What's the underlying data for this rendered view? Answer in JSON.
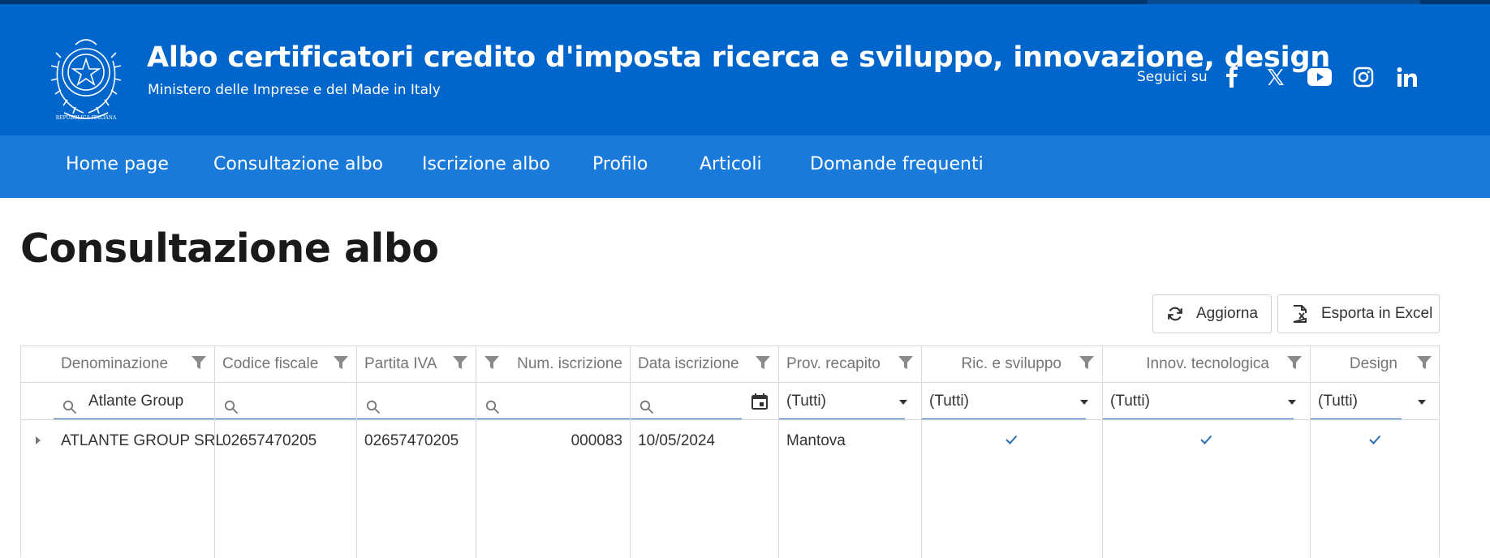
{
  "header": {
    "title": "Albo certificatori credito d'imposta ricerca e sviluppo, innovazione, design",
    "subtitle": "Ministero delle Imprese e del Made in Italy",
    "emblem_text": "REPUBBLICA ITALIANA",
    "follow_label": "Seguici su",
    "social": [
      "facebook-icon",
      "x-icon",
      "youtube-icon",
      "instagram-icon",
      "linkedin-icon"
    ],
    "background": "#0066cc"
  },
  "nav": {
    "items": [
      "Home page",
      "Consultazione albo",
      "Iscrizione albo",
      "Profilo",
      "Articoli",
      "Domande frequenti"
    ],
    "background": "#1a7ad9"
  },
  "page": {
    "title": "Consultazione albo"
  },
  "toolbar": {
    "refresh_label": "Aggiorna",
    "refresh_icon": "refresh-icon",
    "export_label": "Esporta in Excel",
    "export_icon": "excel-export-icon"
  },
  "grid": {
    "columns": [
      "Denominazione",
      "Codice fiscale",
      "Partita IVA",
      "Num. iscrizione",
      "Data iscrizione",
      "Prov. recapito",
      "Ric. e sviluppo",
      "Innov. tecnologica",
      "Design"
    ],
    "filters": {
      "denominazione": "Atlante Group",
      "prov_recapito": "(Tutti)",
      "ric_sviluppo": "(Tutti)",
      "innov_tecnologica": "(Tutti)",
      "design": "(Tutti)"
    },
    "rows": [
      {
        "denominazione": "ATLANTE GROUP SRL",
        "codice_fiscale": "02657470205",
        "partita_iva": "02657470205",
        "num_iscrizione": "000083",
        "data_iscrizione": "10/05/2024",
        "prov_recapito": "Mantova",
        "ric_sviluppo": true,
        "innov_tecnologica": true,
        "design": true
      }
    ],
    "accent": "#2a6db5"
  }
}
